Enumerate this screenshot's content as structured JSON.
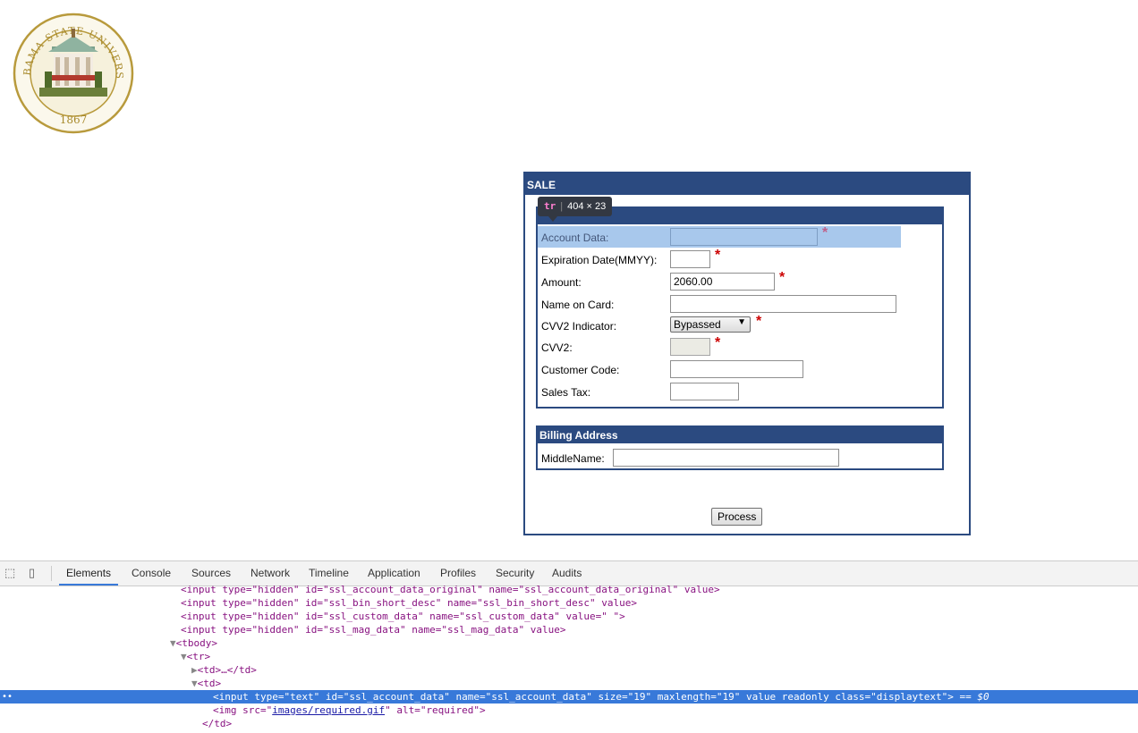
{
  "logo": {
    "name": "Alabama State University seal",
    "text_top": "ALABAMA STATE UNIVERSITY",
    "year": "1867"
  },
  "sale": {
    "title": "SALE",
    "fields": [
      {
        "label": "Account Data:",
        "value": "",
        "required": true,
        "state": "readonly"
      },
      {
        "label": "Expiration Date(MMYY):",
        "value": "",
        "required": true
      },
      {
        "label": "Amount:",
        "value": "2060.00",
        "required": true
      },
      {
        "label": "Name on Card:",
        "value": "",
        "required": false
      },
      {
        "label": "CVV2 Indicator:",
        "value": "Bypassed",
        "required": true,
        "type": "select"
      },
      {
        "label": "CVV2:",
        "value": "",
        "required": true,
        "state": "disabled"
      },
      {
        "label": "Customer Code:",
        "value": "",
        "required": false
      },
      {
        "label": "Sales Tax:",
        "value": "",
        "required": false
      }
    ],
    "required_mark": "*",
    "billing": {
      "title": "Billing Address",
      "middle_name_label": "MiddleName:",
      "middle_name_value": ""
    },
    "process_label": "Process"
  },
  "tooltip": {
    "tag": "tr",
    "size": "404 × 23"
  },
  "devtools": {
    "tabs": [
      "Elements",
      "Console",
      "Sources",
      "Network",
      "Timeline",
      "Application",
      "Profiles",
      "Security",
      "Audits"
    ],
    "active_tab": "Elements",
    "code": {
      "l1": "<input type=\"hidden\" id=\"ssl_account_data_original\" name=\"ssl_account_data_original\" value>",
      "l2": "<input type=\"hidden\" id=\"ssl_bin_short_desc\" name=\"ssl_bin_short_desc\" value>",
      "l3": "<input type=\"hidden\" id=\"ssl_custom_data\" name=\"ssl_custom_data\" value=\" \">",
      "l4": "<input type=\"hidden\" id=\"ssl_mag_data\" name=\"ssl_mag_data\" value>",
      "l5": "<tbody>",
      "l6": "<tr>",
      "l7": "<td>…</td>",
      "l8": "<td>",
      "l9": "<input type=\"text\" id=\"ssl_account_data\" name=\"ssl_account_data\" size=\"19\" maxlength=\"19\" value readonly class=\"displaytext\">",
      "l9_suffix": " == $0",
      "l10_pre": "<img src=\"",
      "l10_link": "images/required.gif",
      "l10_post": "\" alt=\"required\">",
      "l11": "</td>"
    }
  }
}
